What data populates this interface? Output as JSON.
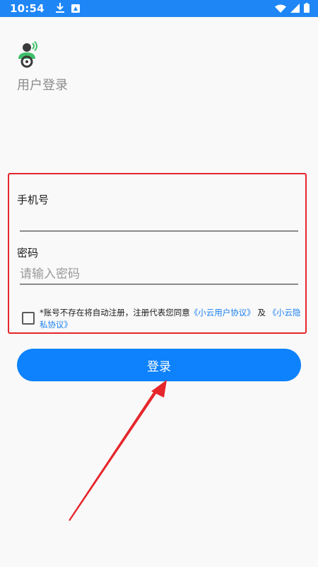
{
  "status_bar": {
    "time": "10:54",
    "icons": [
      "download-icon",
      "app-icon",
      "wifi-icon",
      "signal-icon",
      "battery-icon"
    ]
  },
  "header": {
    "logo_icon": "user-broadcast-logo",
    "title": "用户登录"
  },
  "form": {
    "phone_label": "手机号",
    "phone_value": "",
    "password_label": "密码",
    "password_placeholder": "请输入密码",
    "agreement_prefix": "*账号不存在将自动注册，注册代表您同意",
    "agreement_link1": "《小云用户协议》",
    "agreement_and": " 及 ",
    "agreement_link2": "《小云隐私协议》"
  },
  "login_button": {
    "label": "登录"
  },
  "colors": {
    "status_bar": "#1f86f5",
    "primary": "#0d82fc",
    "link": "#1a7ff0",
    "highlight_frame": "#e5262b",
    "logo_green": "#3fbf6a"
  }
}
